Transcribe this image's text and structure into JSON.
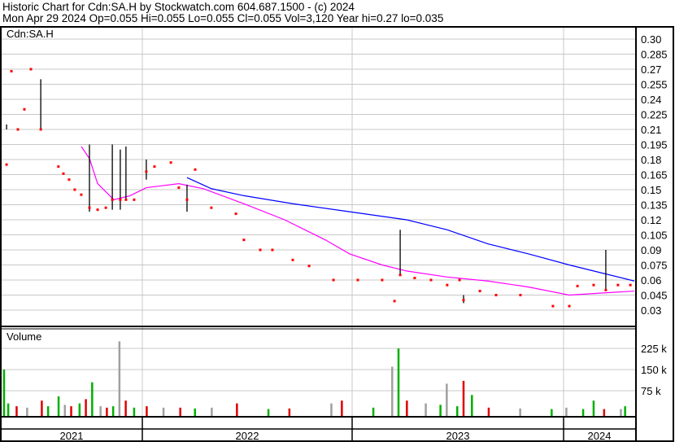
{
  "header": {
    "title": "Historic Chart for Cdn:SA.H by Stockwatch.com 604.687.1500 - (c) 2024",
    "quote": "Mon Apr 29 2024  Op=0.055  Hi=0.055  Lo=0.055  Cl=0.055  Vol=3,120  Year hi=0.27  lo=0.035"
  },
  "chart_data": [
    {
      "type": "scatter",
      "title": "Cdn:SA.H",
      "ylim": [
        0.02,
        0.31
      ],
      "xlim": [
        2021.33,
        2024.35
      ],
      "yticks": [
        "0.30",
        "0.285",
        "0.27",
        "0.255",
        "0.24",
        "0.225",
        "0.21",
        "0.195",
        "0.18",
        "0.165",
        "0.15",
        "0.135",
        "0.12",
        "0.105",
        "0.09",
        "0.075",
        "0.06",
        "0.045",
        "0.03"
      ],
      "colors": {
        "close": "#ff0000",
        "bar": "#000000",
        "ma_long": "#0000ff",
        "ma_short": "#ff00ff",
        "grid": "#c8c8c8"
      },
      "closes": [
        [
          2021.353,
          0.175
        ],
        [
          2021.376,
          0.268
        ],
        [
          2021.407,
          0.21
        ],
        [
          2021.438,
          0.23
        ],
        [
          2021.469,
          0.27
        ],
        [
          2021.516,
          0.21
        ],
        [
          2021.6,
          0.173
        ],
        [
          2021.624,
          0.166
        ],
        [
          2021.651,
          0.16
        ],
        [
          2021.678,
          0.15
        ],
        [
          2021.709,
          0.145
        ],
        [
          2021.748,
          0.132
        ],
        [
          2021.787,
          0.13
        ],
        [
          2021.826,
          0.132
        ],
        [
          2021.857,
          0.14
        ],
        [
          2021.895,
          0.14
        ],
        [
          2021.922,
          0.14
        ],
        [
          2021.961,
          0.14
        ],
        [
          2022.019,
          0.168
        ],
        [
          2022.058,
          0.173
        ],
        [
          2022.136,
          0.177
        ],
        [
          2022.174,
          0.152
        ],
        [
          2022.213,
          0.14
        ],
        [
          2022.252,
          0.17
        ],
        [
          2022.329,
          0.132
        ],
        [
          2022.446,
          0.126
        ],
        [
          2022.484,
          0.1
        ],
        [
          2022.562,
          0.09
        ],
        [
          2022.62,
          0.09
        ],
        [
          2022.717,
          0.08
        ],
        [
          2022.795,
          0.074
        ],
        [
          2022.911,
          0.06
        ],
        [
          2023.027,
          0.06
        ],
        [
          2023.143,
          0.06
        ],
        [
          2023.202,
          0.039
        ],
        [
          2023.229,
          0.065
        ],
        [
          2023.298,
          0.062
        ],
        [
          2023.376,
          0.06
        ],
        [
          2023.453,
          0.055
        ],
        [
          2023.512,
          0.06
        ],
        [
          2023.531,
          0.04
        ],
        [
          2023.609,
          0.049
        ],
        [
          2023.686,
          0.045
        ],
        [
          2023.802,
          0.045
        ],
        [
          2023.957,
          0.034
        ],
        [
          2024.035,
          0.034
        ],
        [
          2024.074,
          0.054
        ],
        [
          2024.151,
          0.055
        ],
        [
          2024.209,
          0.05
        ],
        [
          2024.267,
          0.055
        ],
        [
          2024.326,
          0.055
        ]
      ],
      "ranges": [
        [
          2021.516,
          0.21,
          0.26
        ],
        [
          2021.748,
          0.128,
          0.195
        ],
        [
          2021.857,
          0.13,
          0.195
        ],
        [
          2021.895,
          0.13,
          0.19
        ],
        [
          2021.922,
          0.14,
          0.193
        ],
        [
          2022.019,
          0.16,
          0.18
        ],
        [
          2022.213,
          0.128,
          0.155
        ],
        [
          2023.229,
          0.065,
          0.11
        ],
        [
          2024.209,
          0.05,
          0.09
        ],
        [
          2021.353,
          0.21,
          0.215
        ],
        [
          2023.531,
          0.037,
          0.045
        ]
      ],
      "ma_long": [
        [
          2022.213,
          0.162
        ],
        [
          2022.329,
          0.151
        ],
        [
          2022.484,
          0.144
        ],
        [
          2022.717,
          0.136
        ],
        [
          2022.988,
          0.128
        ],
        [
          2023.259,
          0.12
        ],
        [
          2023.453,
          0.11
        ],
        [
          2023.647,
          0.096
        ],
        [
          2023.841,
          0.086
        ],
        [
          2024.035,
          0.075
        ],
        [
          2024.19,
          0.067
        ],
        [
          2024.345,
          0.059
        ]
      ],
      "ma_short": [
        [
          2021.709,
          0.193
        ],
        [
          2021.748,
          0.181
        ],
        [
          2021.787,
          0.156
        ],
        [
          2021.864,
          0.14
        ],
        [
          2021.942,
          0.144
        ],
        [
          2022.019,
          0.152
        ],
        [
          2022.097,
          0.154
        ],
        [
          2022.174,
          0.156
        ],
        [
          2022.291,
          0.151
        ],
        [
          2022.484,
          0.136
        ],
        [
          2022.678,
          0.12
        ],
        [
          2022.872,
          0.1
        ],
        [
          2022.988,
          0.086
        ],
        [
          2023.143,
          0.075
        ],
        [
          2023.259,
          0.069
        ],
        [
          2023.453,
          0.063
        ],
        [
          2023.647,
          0.059
        ],
        [
          2023.841,
          0.053
        ],
        [
          2024.035,
          0.045
        ],
        [
          2024.19,
          0.047
        ],
        [
          2024.345,
          0.049
        ]
      ]
    },
    {
      "type": "bar",
      "title": "Volume",
      "ylim": [
        0,
        300000
      ],
      "yticks": [
        "225 k",
        "150 k",
        "75 k"
      ],
      "colors": {
        "up": "#00b000",
        "down": "#e00000",
        "flat": "#a0a0a0"
      },
      "bars": [
        [
          2021.34,
          150000,
          "up"
        ],
        [
          2021.36,
          30000,
          "up"
        ],
        [
          2021.4,
          20000,
          "down"
        ],
        [
          2021.45,
          15000,
          "flat"
        ],
        [
          2021.52,
          40000,
          "down"
        ],
        [
          2021.55,
          20000,
          "up"
        ],
        [
          2021.6,
          55000,
          "up"
        ],
        [
          2021.63,
          25000,
          "flat"
        ],
        [
          2021.66,
          20000,
          "down"
        ],
        [
          2021.7,
          30000,
          "up"
        ],
        [
          2021.73,
          45000,
          "down"
        ],
        [
          2021.76,
          105000,
          "up"
        ],
        [
          2021.8,
          20000,
          "flat"
        ],
        [
          2021.83,
          15000,
          "down"
        ],
        [
          2021.86,
          20000,
          "up"
        ],
        [
          2021.89,
          250000,
          "flat"
        ],
        [
          2021.92,
          40000,
          "down"
        ],
        [
          2021.96,
          15000,
          "up"
        ],
        [
          2022.02,
          20000,
          "down"
        ],
        [
          2022.1,
          15000,
          "flat"
        ],
        [
          2022.18,
          15000,
          "down"
        ],
        [
          2022.25,
          12000,
          "up"
        ],
        [
          2022.33,
          15000,
          "flat"
        ],
        [
          2022.45,
          30000,
          "down"
        ],
        [
          2022.6,
          10000,
          "up"
        ],
        [
          2022.7,
          12000,
          "down"
        ],
        [
          2022.9,
          30000,
          "flat"
        ],
        [
          2022.95,
          40000,
          "down"
        ],
        [
          2023.1,
          15000,
          "up"
        ],
        [
          2023.19,
          160000,
          "flat"
        ],
        [
          2023.22,
          225000,
          "up"
        ],
        [
          2023.26,
          40000,
          "down"
        ],
        [
          2023.35,
          30000,
          "flat"
        ],
        [
          2023.42,
          25000,
          "up"
        ],
        [
          2023.45,
          100000,
          "flat"
        ],
        [
          2023.5,
          20000,
          "up"
        ],
        [
          2023.53,
          110000,
          "down"
        ],
        [
          2023.57,
          60000,
          "up"
        ],
        [
          2023.65,
          15000,
          "down"
        ],
        [
          2023.8,
          12000,
          "flat"
        ],
        [
          2023.95,
          10000,
          "up"
        ],
        [
          2024.02,
          15000,
          "flat"
        ],
        [
          2024.1,
          10000,
          "up"
        ],
        [
          2024.15,
          40000,
          "up"
        ],
        [
          2024.2,
          10000,
          "down"
        ],
        [
          2024.28,
          10000,
          "flat"
        ],
        [
          2024.3,
          20000,
          "up"
        ]
      ]
    },
    {
      "type": "axis",
      "years": [
        "2021",
        "2022",
        "2023",
        "2024"
      ]
    }
  ]
}
